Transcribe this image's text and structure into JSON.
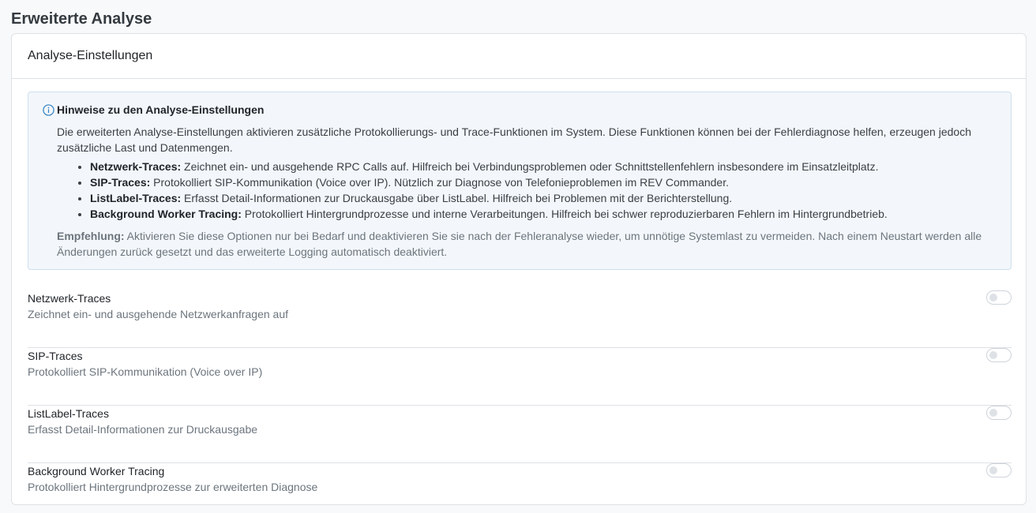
{
  "page": {
    "title": "Erweiterte Analyse"
  },
  "card": {
    "header": "Analyse-Einstellungen",
    "info": {
      "icon": "info-circle-icon",
      "title": "Hinweise zu den Analyse-Einstellungen",
      "intro": "Die erweiterten Analyse-Einstellungen aktivieren zusätzliche Protokollierungs- und Trace-Funktionen im System. Diese Funktionen können bei der Fehlerdiagnose helfen, erzeugen jedoch zusätzliche Last und Datenmengen.",
      "items": [
        {
          "term": "Netzwerk-Traces:",
          "text": " Zeichnet ein- und ausgehende RPC Calls auf. Hilfreich bei Verbindungsproblemen oder Schnittstellenfehlern insbesondere im Einsatzleitplatz."
        },
        {
          "term": "SIP-Traces:",
          "text": " Protokolliert SIP-Kommunikation (Voice over IP). Nützlich zur Diagnose von Telefonieproblemen im REV Commander."
        },
        {
          "term": "ListLabel-Traces:",
          "text": " Erfasst Detail-Informationen zur Druckausgabe über ListLabel. Hilfreich bei Problemen mit der Berichterstellung."
        },
        {
          "term": "Background Worker Tracing:",
          "text": " Protokolliert Hintergrundprozesse und interne Verarbeitungen. Hilfreich bei schwer reproduzierbaren Fehlern im Hintergrundbetrieb."
        }
      ],
      "recommendation_label": "Empfehlung:",
      "recommendation_text": " Aktivieren Sie diese Optionen nur bei Bedarf und deaktivieren Sie sie nach der Fehleranalyse wieder, um unnötige Systemlast zu vermeiden. Nach einem Neustart werden alle Änderungen zurück gesetzt und das erweiterte Logging automatisch deaktiviert."
    },
    "settings": [
      {
        "label": "Netzwerk-Traces",
        "description": "Zeichnet ein- und ausgehende Netzwerkanfragen auf",
        "enabled": false
      },
      {
        "label": "SIP-Traces",
        "description": "Protokolliert SIP-Kommunikation (Voice over IP)",
        "enabled": false
      },
      {
        "label": "ListLabel-Traces",
        "description": "Erfasst Detail-Informationen zur Druckausgabe",
        "enabled": false
      },
      {
        "label": "Background Worker Tracing",
        "description": "Protokolliert Hintergrundprozesse zur erweiterten Diagnose",
        "enabled": false
      }
    ]
  },
  "colors": {
    "info_icon": "#2f7fc1",
    "info_bg": "#f3f7fb",
    "border": "#dee2e6"
  }
}
